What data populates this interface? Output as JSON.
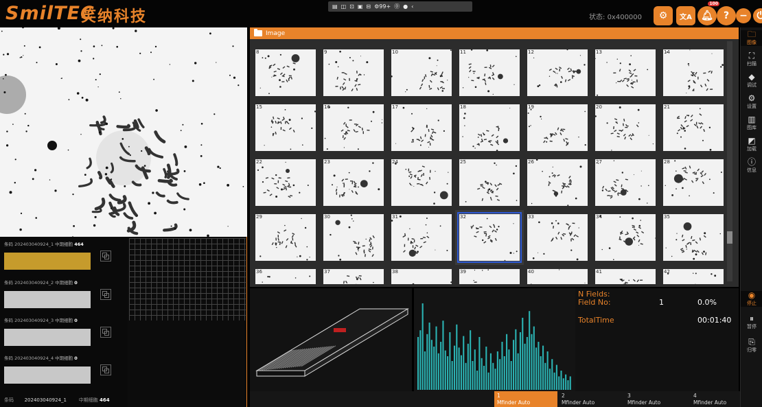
{
  "header": {
    "logo_text": "SmilTEC",
    "logo_cn": "笑纳科技",
    "status_label": "状态:",
    "status_value": "0x400000",
    "taskbar_items": [
      "▤",
      "◫",
      "⊡",
      "▣",
      "⊟",
      "⚙99+",
      "⓪",
      "●",
      "‹"
    ],
    "notification_count": "100"
  },
  "left": {
    "slides": [
      {
        "code_label": "条码",
        "code": "202403040924_1",
        "count_label": "中期细胞",
        "count": "464"
      },
      {
        "code_label": "条码",
        "code": "202403040924_2",
        "count_label": "中期细胞",
        "count": "0"
      },
      {
        "code_label": "条码",
        "code": "202403040924_3",
        "count_label": "中期细胞",
        "count": "0"
      },
      {
        "code_label": "条码",
        "code": "202403040924_4",
        "count_label": "中期细胞",
        "count": "0"
      }
    ],
    "footer": {
      "code_label": "条码",
      "code": "202403040924_1",
      "count_label": "中期细胞",
      "count": "464"
    }
  },
  "image_panel": {
    "title": "Image",
    "thumbnail_numbers": [
      "8",
      "9",
      "10",
      "11",
      "12",
      "13",
      "14",
      "15",
      "16",
      "17",
      "18",
      "19",
      "20",
      "21",
      "22",
      "23",
      "24",
      "25",
      "26",
      "27",
      "28",
      "29",
      "30",
      "31",
      "32",
      "33",
      "34",
      "35",
      "36",
      "37",
      "38",
      "39",
      "40",
      "41",
      "42"
    ],
    "selected": "32"
  },
  "info": {
    "n_fields_label": "N Fields:",
    "field_no_label": "Field No:",
    "field_no_value": "1",
    "field_pct": "0.0%",
    "total_time_label": "TotalTime",
    "total_time_value": "00:01:40"
  },
  "histogram": {
    "values": [
      0.55,
      0.62,
      0.9,
      0.4,
      0.58,
      0.7,
      0.52,
      0.45,
      0.66,
      0.38,
      0.5,
      0.72,
      0.41,
      0.35,
      0.6,
      0.3,
      0.46,
      0.68,
      0.44,
      0.36,
      0.56,
      0.28,
      0.48,
      0.62,
      0.3,
      0.42,
      0.2,
      0.55,
      0.33,
      0.25,
      0.45,
      0.18,
      0.38,
      0.28,
      0.22,
      0.4,
      0.32,
      0.5,
      0.35,
      0.58,
      0.42,
      0.3,
      0.52,
      0.63,
      0.38,
      0.6,
      0.75,
      0.48,
      0.55,
      0.82,
      0.58,
      0.66,
      0.44,
      0.5,
      0.35,
      0.46,
      0.28,
      0.4,
      0.22,
      0.32,
      0.18,
      0.26,
      0.14,
      0.2,
      0.12,
      0.16,
      0.1,
      0.14
    ],
    "color": "#2bb3b3"
  },
  "tabs": [
    {
      "num": "1",
      "label": "Mfinder Auto"
    },
    {
      "num": "2",
      "label": "Mfinder Auto"
    },
    {
      "num": "3",
      "label": "Mfinder Auto"
    },
    {
      "num": "4",
      "label": "Mfinder Auto"
    },
    {
      "num": "(",
      "label": ""
    }
  ],
  "rail": {
    "top": [
      {
        "label": "图像",
        "icon": "image-icon",
        "glyph": "🗀"
      },
      {
        "label": "扫描",
        "icon": "scan-icon",
        "glyph": "⛶"
      },
      {
        "label": "调试",
        "icon": "debug-icon",
        "glyph": "◆"
      },
      {
        "label": "设置",
        "icon": "settings-icon",
        "glyph": "⚙"
      },
      {
        "label": "图库",
        "icon": "library-icon",
        "glyph": "▥"
      },
      {
        "label": "加载",
        "icon": "load-icon",
        "glyph": "◩"
      },
      {
        "label": "信息",
        "icon": "info-icon",
        "glyph": "ⓘ"
      }
    ],
    "bottom": [
      {
        "label": "停止",
        "icon": "stop-icon",
        "glyph": "◉"
      },
      {
        "label": "暂停",
        "icon": "pause-icon",
        "glyph": "⏸"
      },
      {
        "label": "归零",
        "icon": "reset-icon",
        "glyph": "⎘"
      }
    ]
  },
  "colors": {
    "accent": "#e8832a",
    "select": "#2d5ad6"
  }
}
